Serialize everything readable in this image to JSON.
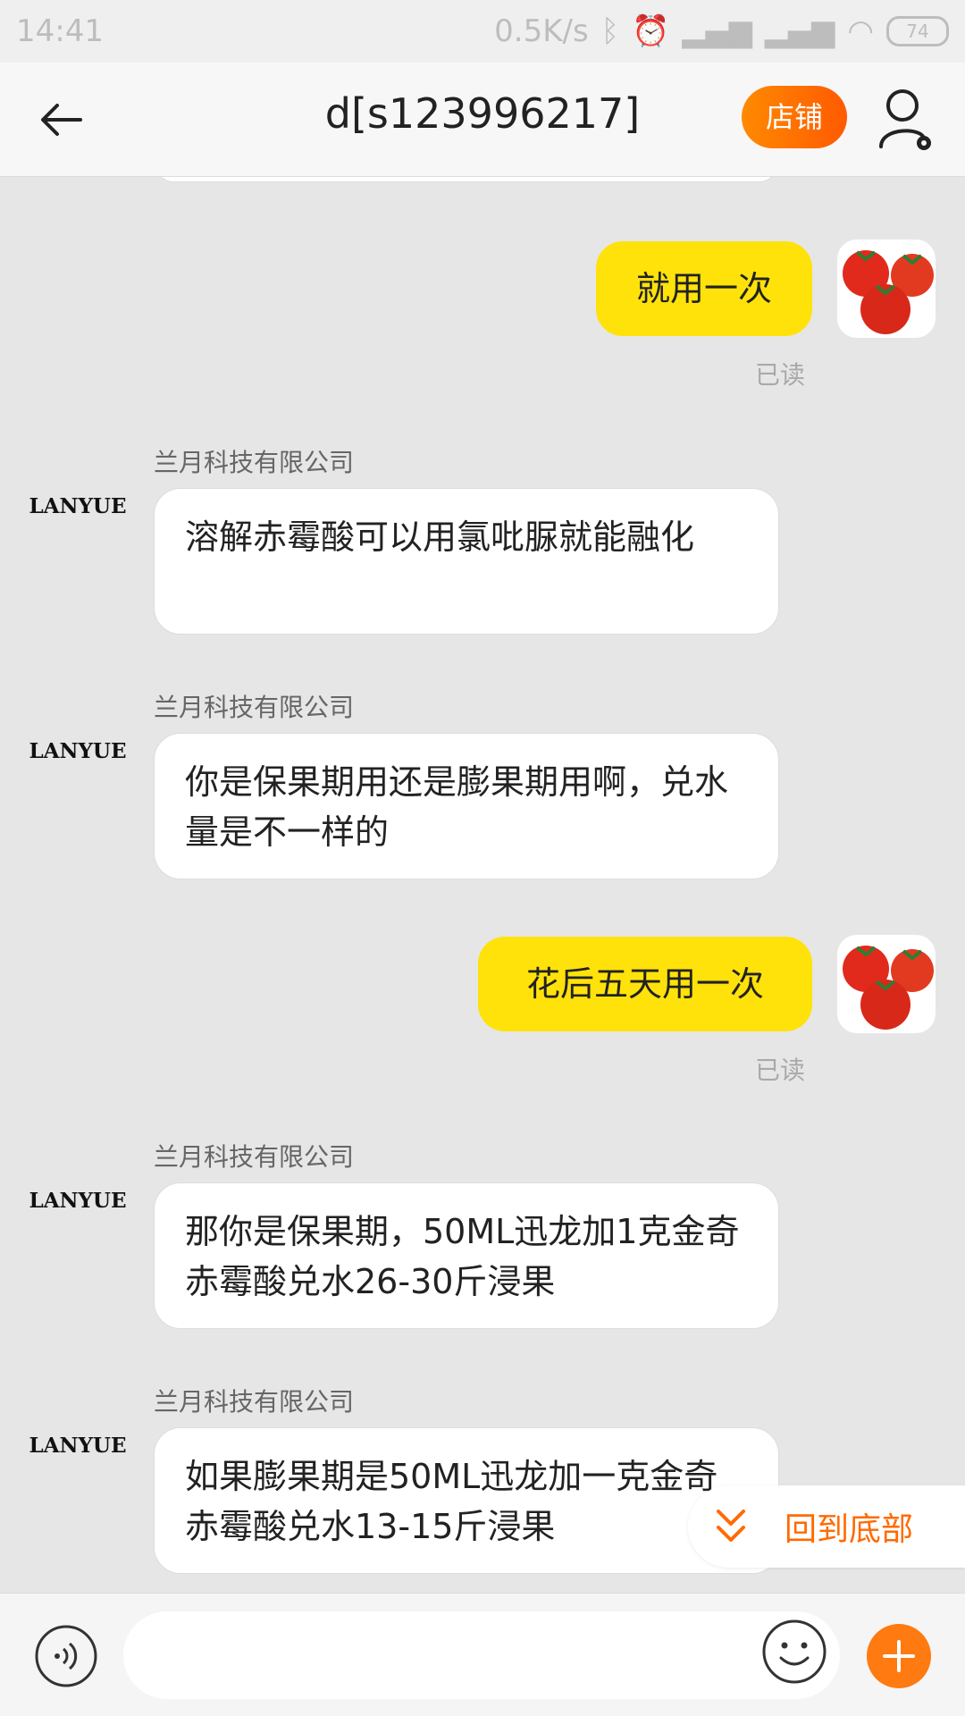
{
  "status_bar": {
    "time": "14:41",
    "network_speed": "0.5K/s",
    "battery": "74"
  },
  "header": {
    "title": "d[s123996217]",
    "shop_label": "店铺",
    "back_icon": "back-arrow-icon",
    "user_settings_icon": "user-settings-icon"
  },
  "messages": [
    {
      "side": "me",
      "text": "就用一次",
      "status": "已读"
    },
    {
      "side": "them",
      "sender": "兰月科技有限公司",
      "avatar_text": "LANYUE",
      "text": "溶解赤霉酸可以用氯吡脲就能融化"
    },
    {
      "side": "them",
      "sender": "兰月科技有限公司",
      "avatar_text": "LANYUE",
      "text": "你是保果期用还是膨果期用啊，兑水量是不一样的"
    },
    {
      "side": "me",
      "text": "花后五天用一次",
      "status": "已读"
    },
    {
      "side": "them",
      "sender": "兰月科技有限公司",
      "avatar_text": "LANYUE",
      "text": "那你是保果期，50ML迅龙加1克金奇赤霉酸兑水26-30斤浸果"
    },
    {
      "side": "them",
      "sender": "兰月科技有限公司",
      "avatar_text": "LANYUE",
      "text": "如果膨果期是50ML迅龙加一克金奇赤霉酸兑水13-15斤浸果"
    }
  ],
  "jump_to_bottom": {
    "label": "回到底部"
  },
  "input": {
    "placeholder": "",
    "value": ""
  },
  "colors": {
    "accent": "#ff6a00",
    "my_bubble": "#ffe20a",
    "background": "#e6e6e6"
  }
}
